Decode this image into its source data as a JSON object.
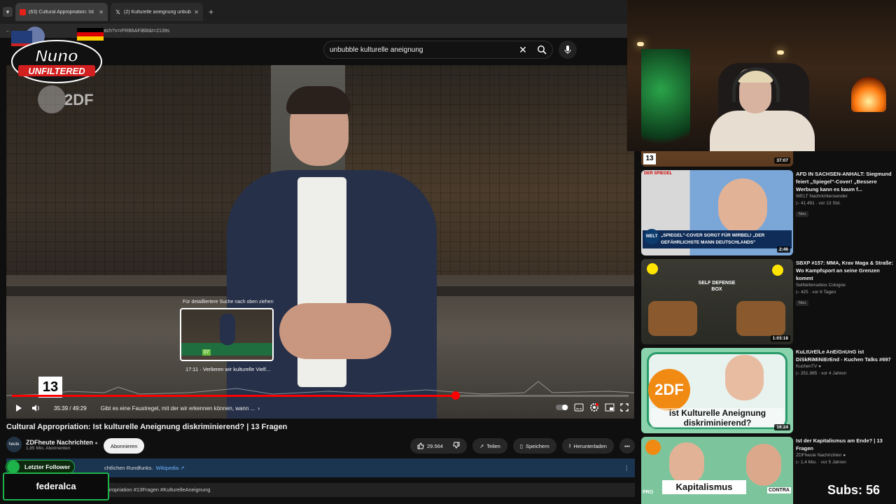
{
  "browser": {
    "tabs": [
      {
        "title": "(63) Cultural Appropriation: Ist",
        "active": true
      },
      {
        "title": "(2) Kulturelle aneignung unbub",
        "active": false
      }
    ],
    "url": "m/watch?v=rFRB6AFiBl8&t=2139s"
  },
  "search": {
    "query": "unbubble kulturelle aneignung"
  },
  "video": {
    "watermark": "2DF",
    "chapter_number": "13",
    "time_current": "35:39",
    "time_total": "49:29",
    "time_display": "35:39 / 49:29",
    "chapter_title": "Gibt es eine Faustregel, mit der wir erkennen können, wann ...",
    "progress_fraction": 0.72,
    "preview": {
      "hint": "Für detailliertere Suche nach oben ziehen",
      "label": "17:11 · Verlieren wir kulturelle Vielf...",
      "badge": "07"
    }
  },
  "title": "Cultural Appropriation: Ist kulturelle Aneignung diskriminierend? | 13 Fragen",
  "channel": {
    "name": "ZDFheute Nachrichten",
    "subs": "1,85 Mio. Abonnenten",
    "avatar_text": "heute"
  },
  "subscribe_label": "Abonnieren",
  "actions": {
    "likes": "29.564",
    "share": "Teilen",
    "save": "Speichern",
    "download": "Herunterladen"
  },
  "infobar": {
    "text": "chtlichen Rundfunks.",
    "link": "Wikipedia ↗"
  },
  "description": "ppropriation #13Fragen #KulturelleAneignung",
  "overlay": {
    "brand_line1": "Nuno",
    "brand_line2": "UNFILTERED",
    "follower_label": "Letzter Follower",
    "follower_name": "federalca",
    "subs_text": "Subs: 56"
  },
  "recommendations": [
    {
      "title": "",
      "channel": "",
      "stats": "",
      "duration": "37:07",
      "badge": "",
      "chapter": "13"
    },
    {
      "title": "AFD IN SACHSEN-ANHALT: Siegmund feiert „Spiegel\"-Cover! „Bessere Werbung kann es kaum f...",
      "channel": "WELT Nachrichtensender",
      "stats": "41.491 · vor 13 Std.",
      "duration": "2:46",
      "badge": "Neu",
      "thumb_caption": "„SPIEGEL\"-COVER SORGT FÜR WIRBEL! „DER GEFÄHRLICHSTE MANN DEUTSCHLANDS\"",
      "thumb_tag": "DER SPIEGEL",
      "thumb_logo": "WELT"
    },
    {
      "title": "SBXP #157: MMA, Krav Maga & Straße: Wo Kampfsport an seine Grenzen kommt",
      "channel": "Selfdefensebox Cologne",
      "stats": "425 · vor 6 Tagen",
      "duration": "1:03:18",
      "badge": "Neu",
      "thumb_caption": "SELF DEFENSE BOX"
    },
    {
      "title": "KuLtUrElLe AnEiGnUnG ist DiSkRiMiNiErEnd - Kuchen Talks #697",
      "channel": "KuchenTV",
      "stats": "251.985 · vor 4 Jahren",
      "duration": "16:24",
      "badge": "",
      "thumb_caption": "ist Kulturelle Aneignung diskriminierend?",
      "thumb_logo": "2DF"
    },
    {
      "title": "Ist der Kapitalismus am Ende? | 13 Fragen",
      "channel": "ZDFheute Nachrichten",
      "stats": "1,4 Mio. · vor 5 Jahren",
      "duration": "",
      "badge": "",
      "thumb_caption": "Kapitalismus",
      "thumb_tag_left": "PRO",
      "thumb_tag_right": "CONTRA"
    }
  ],
  "colors": {
    "accent": "#ff0000",
    "follower_green": "#1db34a",
    "infobar": "#1b3450"
  }
}
